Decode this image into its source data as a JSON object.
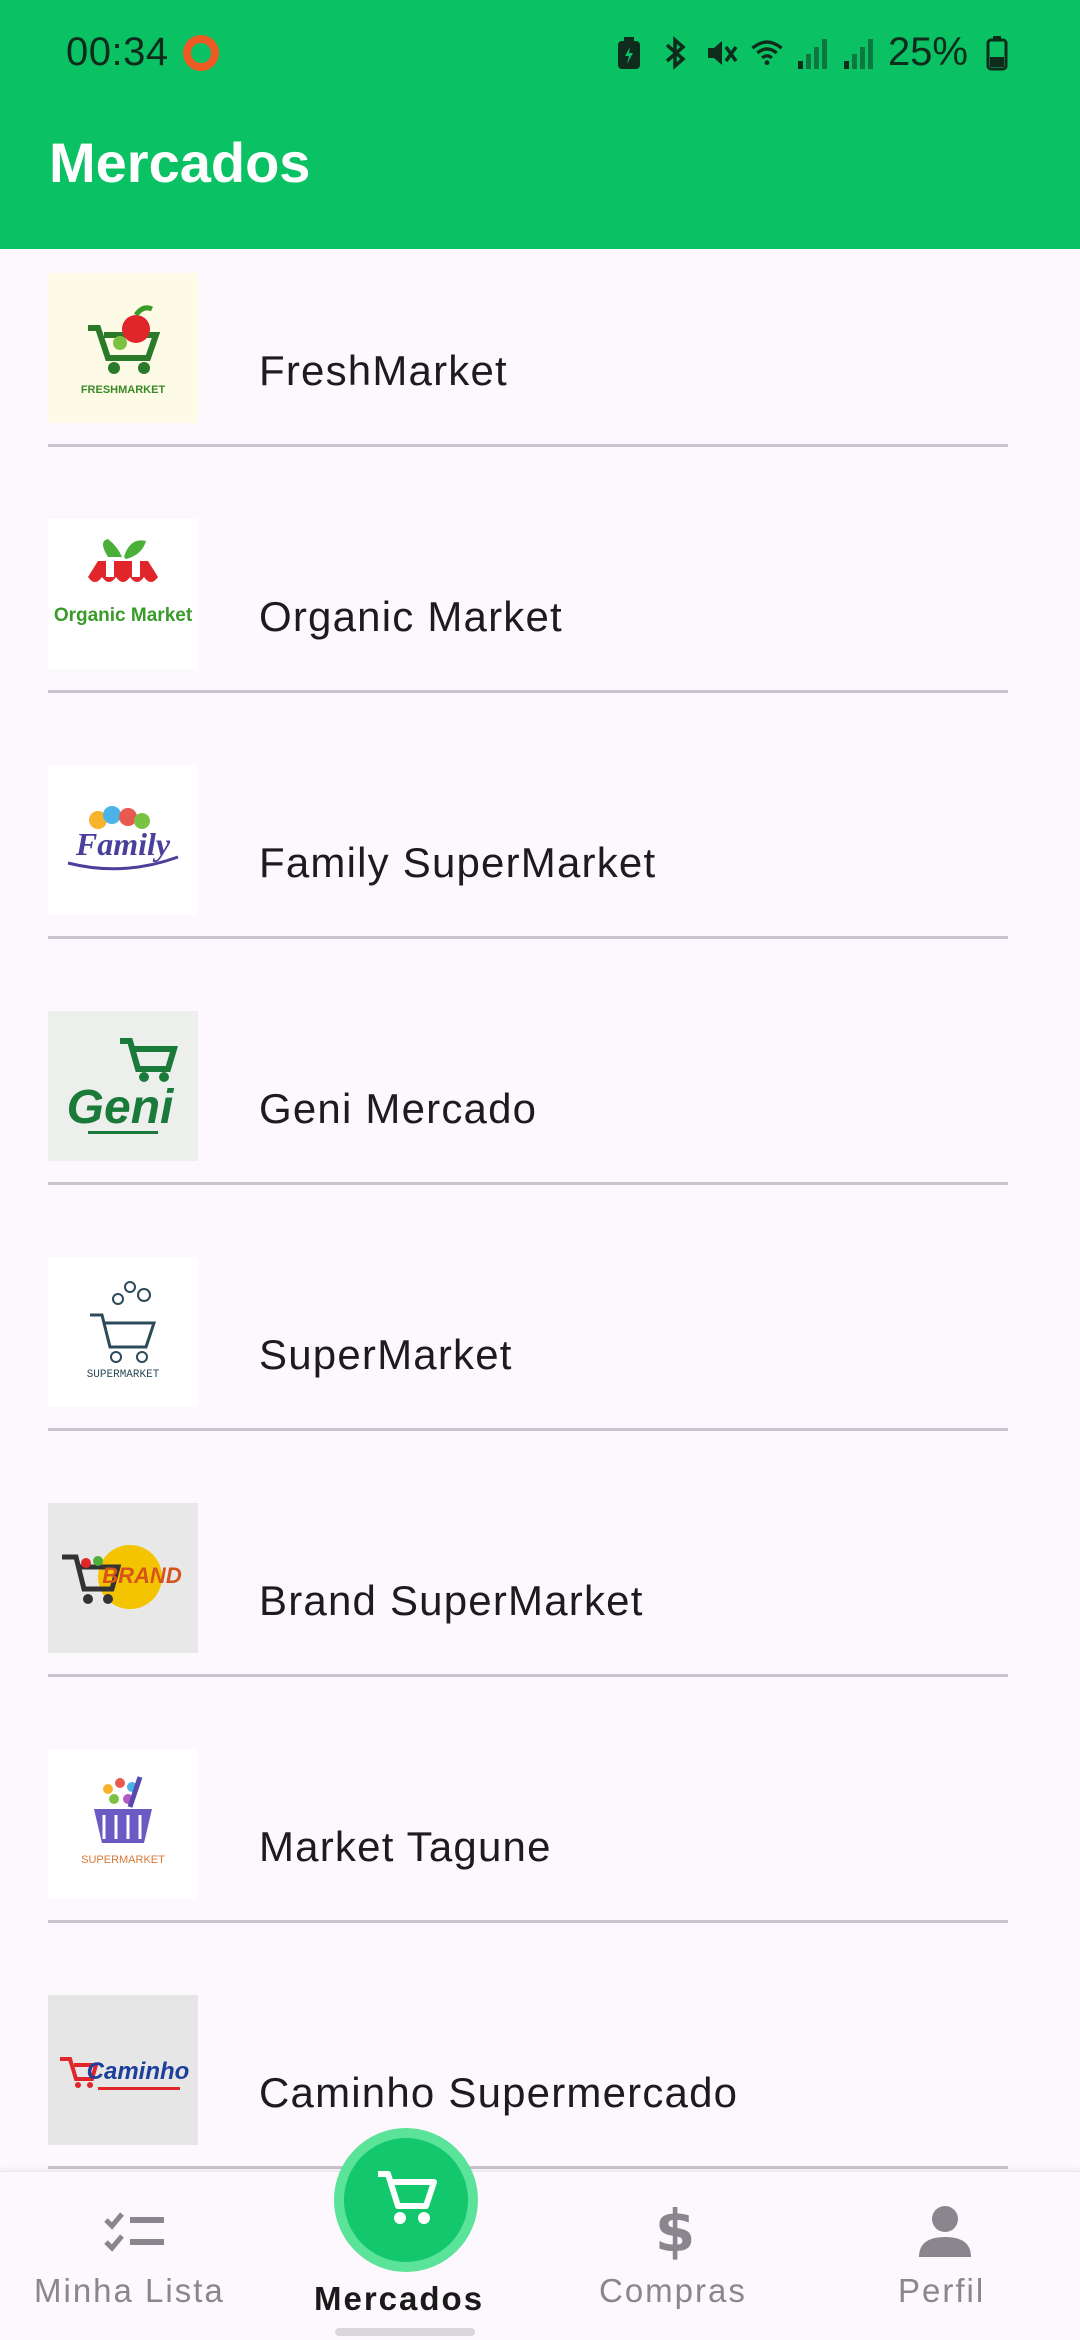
{
  "status_bar": {
    "time": "00:34",
    "battery": "25%"
  },
  "app_bar": {
    "title": "Mercados"
  },
  "markets": [
    {
      "name": "FreshMarket",
      "logo": "fresh-market-logo",
      "logo_text": "FRESHMARKET"
    },
    {
      "name": "Organic Market",
      "logo": "organic-market-logo",
      "logo_text": "Organic Market"
    },
    {
      "name": "Family SuperMarket",
      "logo": "family-supermarket-logo",
      "logo_text": "Family"
    },
    {
      "name": "Geni Mercado",
      "logo": "geni-mercado-logo",
      "logo_text": "Geni"
    },
    {
      "name": "SuperMarket",
      "logo": "supermarket-logo",
      "logo_text": "SUPERMARKET"
    },
    {
      "name": "Brand SuperMarket",
      "logo": "brand-supermarket-logo",
      "logo_text": "BRAND"
    },
    {
      "name": "Market Tagune",
      "logo": "market-tagune-logo",
      "logo_text": "SUPERMARKET"
    },
    {
      "name": "Caminho Supermercado",
      "logo": "caminho-supermercado-logo",
      "logo_text": "Caminho"
    }
  ],
  "bottom_nav": {
    "items": [
      {
        "label": "Minha Lista",
        "icon": "checklist-icon",
        "active": false
      },
      {
        "label": "Mercados",
        "icon": "cart-icon",
        "active": true
      },
      {
        "label": "Compras",
        "icon": "dollar-icon",
        "active": false
      },
      {
        "label": "Perfil",
        "icon": "person-icon",
        "active": false
      }
    ]
  },
  "colors": {
    "primary": "#0ac264",
    "fab": "#13c76c",
    "fab_ring": "#5be39a",
    "background": "#fdf8fd"
  }
}
